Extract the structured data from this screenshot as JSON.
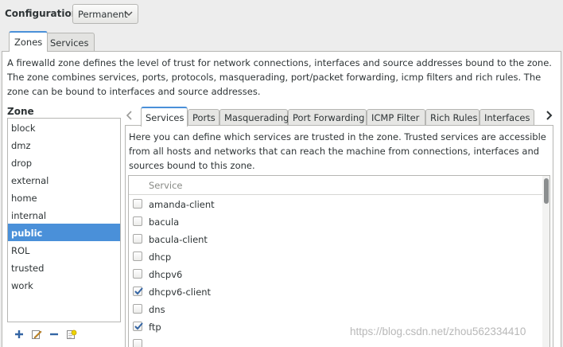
{
  "config": {
    "label": "Configuration:",
    "value": "Permanent"
  },
  "outer_tabs": [
    {
      "label": "Zones",
      "active": true
    },
    {
      "label": "Services",
      "active": false
    }
  ],
  "zone_description": "A firewalld zone defines the level of trust for network connections, interfaces and source addresses bound to the zone. The zone combines services, ports, protocols, masquerading, port/packet forwarding, icmp filters and rich rules. The zone can be bound to interfaces and source addresses.",
  "zone_panel": {
    "heading": "Zone",
    "zones": [
      "block",
      "dmz",
      "drop",
      "external",
      "home",
      "internal",
      "public",
      "ROL",
      "trusted",
      "work"
    ],
    "selected": "public",
    "toolbar_icons": [
      "add-icon",
      "edit-icon",
      "remove-icon",
      "load-defaults-icon"
    ]
  },
  "inner_tabs": [
    {
      "label": "Services",
      "active": true
    },
    {
      "label": "Ports",
      "active": false
    },
    {
      "label": "Masquerading",
      "active": false
    },
    {
      "label": "Port Forwarding",
      "active": false
    },
    {
      "label": "ICMP Filter",
      "active": false
    },
    {
      "label": "Rich Rules",
      "active": false
    },
    {
      "label": "Interfaces",
      "active": false
    }
  ],
  "services_description": "Here you can define which services are trusted in the zone. Trusted services are accessible from all hosts and networks that can reach the machine from connections, interfaces and sources bound to this zone.",
  "services_table": {
    "column_header": "Service",
    "rows": [
      {
        "name": "amanda-client",
        "checked": false
      },
      {
        "name": "bacula",
        "checked": false
      },
      {
        "name": "bacula-client",
        "checked": false
      },
      {
        "name": "dhcp",
        "checked": false
      },
      {
        "name": "dhcpv6",
        "checked": false
      },
      {
        "name": "dhcpv6-client",
        "checked": true
      },
      {
        "name": "dns",
        "checked": false
      },
      {
        "name": "ftp",
        "checked": true
      }
    ]
  },
  "watermark": "https://blog.csdn.net/zhou562334410",
  "colors": {
    "accent": "#4a90d9",
    "panel_bg": "#ffffff",
    "window_bg": "#ededed",
    "border": "#b6b6b3"
  }
}
